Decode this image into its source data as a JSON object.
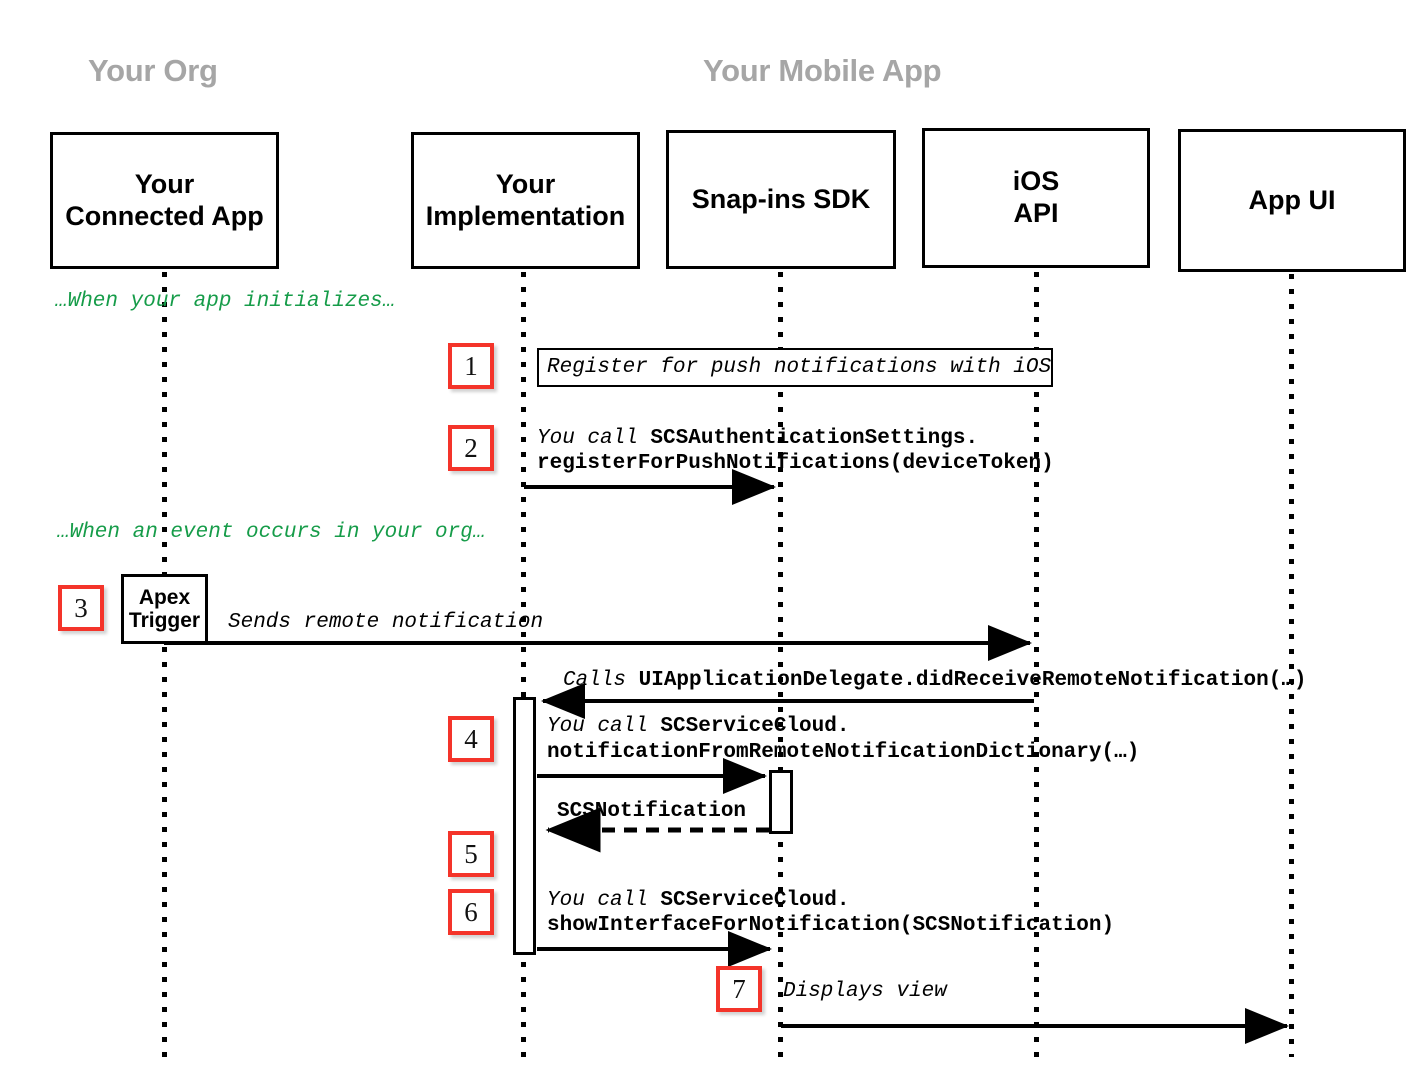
{
  "diagram": {
    "title": "Push notification sequence diagram",
    "accent_red": "#f4342a",
    "note_green": "#169c49",
    "group_gray": "#a6a6a6"
  },
  "groups": [
    {
      "label": "Your Org"
    },
    {
      "label": "Your Mobile App"
    }
  ],
  "participants": [
    {
      "name": "your-connected-app",
      "line1": "Your",
      "line2": "Connected App"
    },
    {
      "name": "your-implementation",
      "line1": "Your",
      "line2": "Implementation"
    },
    {
      "name": "snap-ins-sdk",
      "line1": "Snap-ins SDK",
      "line2": ""
    },
    {
      "name": "ios-api",
      "line1": "iOS",
      "line2": "API"
    },
    {
      "name": "app-ui",
      "line1": "App UI",
      "line2": ""
    }
  ],
  "phase_notes": [
    {
      "text": "…When your app initializes…"
    },
    {
      "text": "…When an event occurs in your org…"
    }
  ],
  "steps": [
    {
      "number": "1"
    },
    {
      "number": "2"
    },
    {
      "number": "3"
    },
    {
      "number": "4"
    },
    {
      "number": "5"
    },
    {
      "number": "6"
    },
    {
      "number": "7"
    }
  ],
  "messages": {
    "step1_note": "Register for push notifications with iOS",
    "step2_line1_italic": "You call ",
    "step2_line1_bold": "SCSAuthenticationSettings.",
    "step2_line2_bold": "registerForPushNotifications(deviceToken)",
    "apex_trigger_line1": "Apex",
    "apex_trigger_line2": "Trigger",
    "step3_label": "Sends remote notification",
    "calls_delegate_italic": "Calls ",
    "calls_delegate_bold": "UIApplicationDelegate.didReceiveRemoteNotification(…)",
    "step4_line1_italic": "You call ",
    "step4_line1_bold": "SCServiceCloud.",
    "step4_line2_bold": "notificationFromRemoteNotificationDictionary(…)",
    "step5_return": "SCSNotification",
    "step6_line1_italic": "You call ",
    "step6_line1_bold": "SCServiceCloud.",
    "step6_line2_bold": "showInterfaceForNotification(SCSNotification)",
    "step7_label": "Displays view"
  }
}
